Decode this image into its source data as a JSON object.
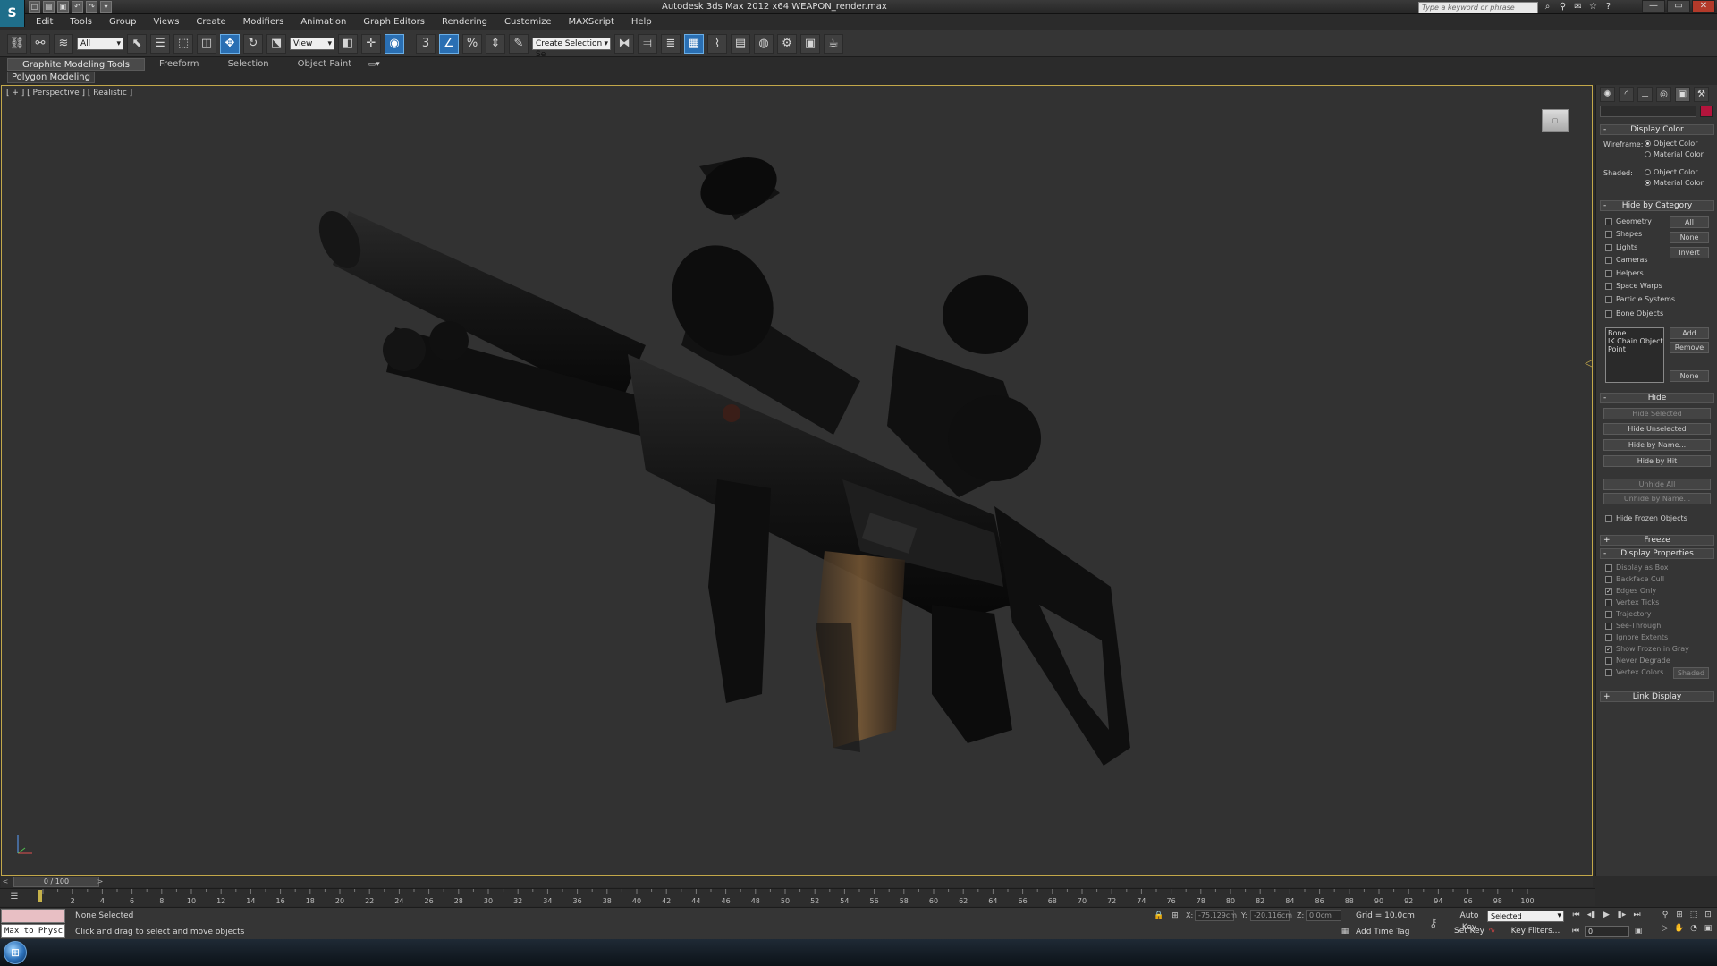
{
  "titlebar": {
    "app_logo": "S",
    "title": "Autodesk 3ds Max  2012 x64     WEAPON_render.max",
    "search_placeholder": "Type a keyword or phrase",
    "quick_access_icons": [
      "new-icon",
      "open-icon",
      "save-icon",
      "undo-icon",
      "redo-icon",
      "hold-icon"
    ],
    "title_tools": [
      "binoculars-icon",
      "search-icon",
      "communication-icon",
      "star-icon",
      "help-icon"
    ],
    "window_controls": {
      "minimize": "—",
      "maximize": "▭",
      "close": "✕"
    }
  },
  "menu": [
    "Edit",
    "Tools",
    "Group",
    "Views",
    "Create",
    "Modifiers",
    "Animation",
    "Graph Editors",
    "Rendering",
    "Customize",
    "MAXScript",
    "Help"
  ],
  "toolbar": {
    "selection_filter": "All",
    "ref_coord": "View",
    "named_selection": "Create Selection Se"
  },
  "ribbon": {
    "tabs": [
      "Graphite Modeling Tools",
      "Freeform",
      "Selection",
      "Object Paint"
    ],
    "active_tab": 0,
    "panel_label": "Polygon Modeling"
  },
  "viewport": {
    "label": "[ + ] [ Perspective ] [ Realistic ]",
    "border_color": "#c3a84a"
  },
  "command_panel": {
    "tab_icons": [
      "create-icon",
      "modify-icon",
      "hierarchy-icon",
      "motion-icon",
      "display-icon",
      "utilities-icon"
    ],
    "active_tab": 4,
    "swatch_color": "#b4143c",
    "display_color": {
      "title": "Display Color",
      "sign": "-",
      "wireframe_label": "Wireframe:",
      "shaded_label": "Shaded:",
      "object_color": "Object Color",
      "material_color": "Material Color",
      "wireframe_selected": "object",
      "shaded_selected": "material"
    },
    "hide_by_category": {
      "title": "Hide by Category",
      "sign": "-",
      "items": [
        "Geometry",
        "Shapes",
        "Lights",
        "Cameras",
        "Helpers",
        "Space Warps",
        "Particle Systems",
        "Bone Objects"
      ],
      "btn_all": "All",
      "btn_none": "None",
      "btn_invert": "Invert",
      "list": [
        "Bone",
        "IK Chain Object",
        "Point"
      ],
      "btn_add": "Add",
      "btn_remove": "Remove",
      "btn_none2": "None"
    },
    "hide": {
      "title": "Hide",
      "sign": "-",
      "hide_selected": "Hide Selected",
      "hide_unselected": "Hide Unselected",
      "hide_by_name": "Hide by Name...",
      "hide_by_hit": "Hide by Hit",
      "unhide_all": "Unhide All",
      "unhide_by_name": "Unhide by Name...",
      "hide_frozen": "Hide Frozen Objects"
    },
    "freeze": {
      "title": "Freeze",
      "sign": "+"
    },
    "display_properties": {
      "title": "Display Properties",
      "sign": "-",
      "items": [
        {
          "label": "Display as Box",
          "checked": false
        },
        {
          "label": "Backface Cull",
          "checked": false
        },
        {
          "label": "Edges Only",
          "checked": true
        },
        {
          "label": "Vertex Ticks",
          "checked": false
        },
        {
          "label": "Trajectory",
          "checked": false
        },
        {
          "label": "See-Through",
          "checked": false
        },
        {
          "label": "Ignore Extents",
          "checked": false
        },
        {
          "label": "Show Frozen in Gray",
          "checked": true
        },
        {
          "label": "Never Degrade",
          "checked": false
        },
        {
          "label": "Vertex Colors",
          "checked": false
        }
      ],
      "shaded_btn": "Shaded"
    },
    "link_display": {
      "title": "Link Display",
      "sign": "+"
    }
  },
  "timeline": {
    "slider_label": "0 / 100",
    "prev": "<",
    "next": ">",
    "ticks": [
      2,
      4,
      6,
      8,
      10,
      12,
      14,
      16,
      18,
      20,
      22,
      24,
      26,
      28,
      30,
      32,
      34,
      36,
      38,
      40,
      42,
      44,
      46,
      48,
      50,
      52,
      54,
      56,
      58,
      60,
      62,
      64,
      66,
      68,
      70,
      72,
      74,
      76,
      78,
      80,
      82,
      84,
      86,
      88,
      90,
      92,
      94,
      96,
      98,
      100
    ]
  },
  "status": {
    "maxscript_text": "Max to Physc.",
    "selection": "None Selected",
    "prompt": "Click and drag to select and move objects",
    "x_label": "X:",
    "x_value": "-75.129cm",
    "y_label": "Y:",
    "y_value": "-20.116cm",
    "z_label": "Z:",
    "z_value": "0.0cm",
    "grid": "Grid = 10.0cm",
    "add_time_tag": "Add Time Tag",
    "auto_key": "Auto Key",
    "set_key": "Set Key",
    "selected_option": "Selected",
    "key_filters": "Key Filters...",
    "frame": "0"
  }
}
